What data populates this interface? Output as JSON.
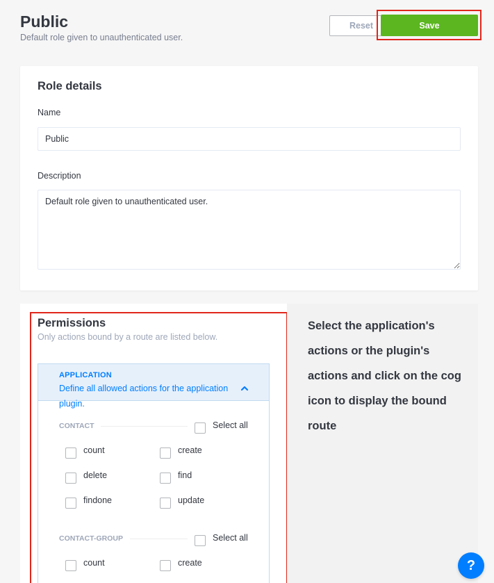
{
  "header": {
    "title": "Public",
    "subtitle": "Default role given to unauthenticated user.",
    "reset_label": "Reset",
    "save_label": "Save"
  },
  "role_details": {
    "title": "Role details",
    "name_label": "Name",
    "name_value": "Public",
    "description_label": "Description",
    "description_value": "Default role given to unauthenticated user."
  },
  "permissions": {
    "title": "Permissions",
    "subtitle": "Only actions bound by a route are listed below.",
    "application": {
      "title": "APPLICATION",
      "description": "Define all allowed actions for the application plugin.",
      "groups": [
        {
          "name": "CONTACT",
          "select_all": "Select all",
          "actions": [
            "count",
            "create",
            "delete",
            "find",
            "findone",
            "update"
          ]
        },
        {
          "name": "CONTACT-GROUP",
          "select_all": "Select all",
          "actions": [
            "count",
            "create"
          ]
        }
      ]
    }
  },
  "side_panel": {
    "text": "Select the application's actions or the plugin's actions and click on the cog icon to display the bound route"
  },
  "help": {
    "label": "?"
  },
  "colors": {
    "accent": "#007eff",
    "save": "#5bb61f",
    "highlight": "#e0261b"
  }
}
